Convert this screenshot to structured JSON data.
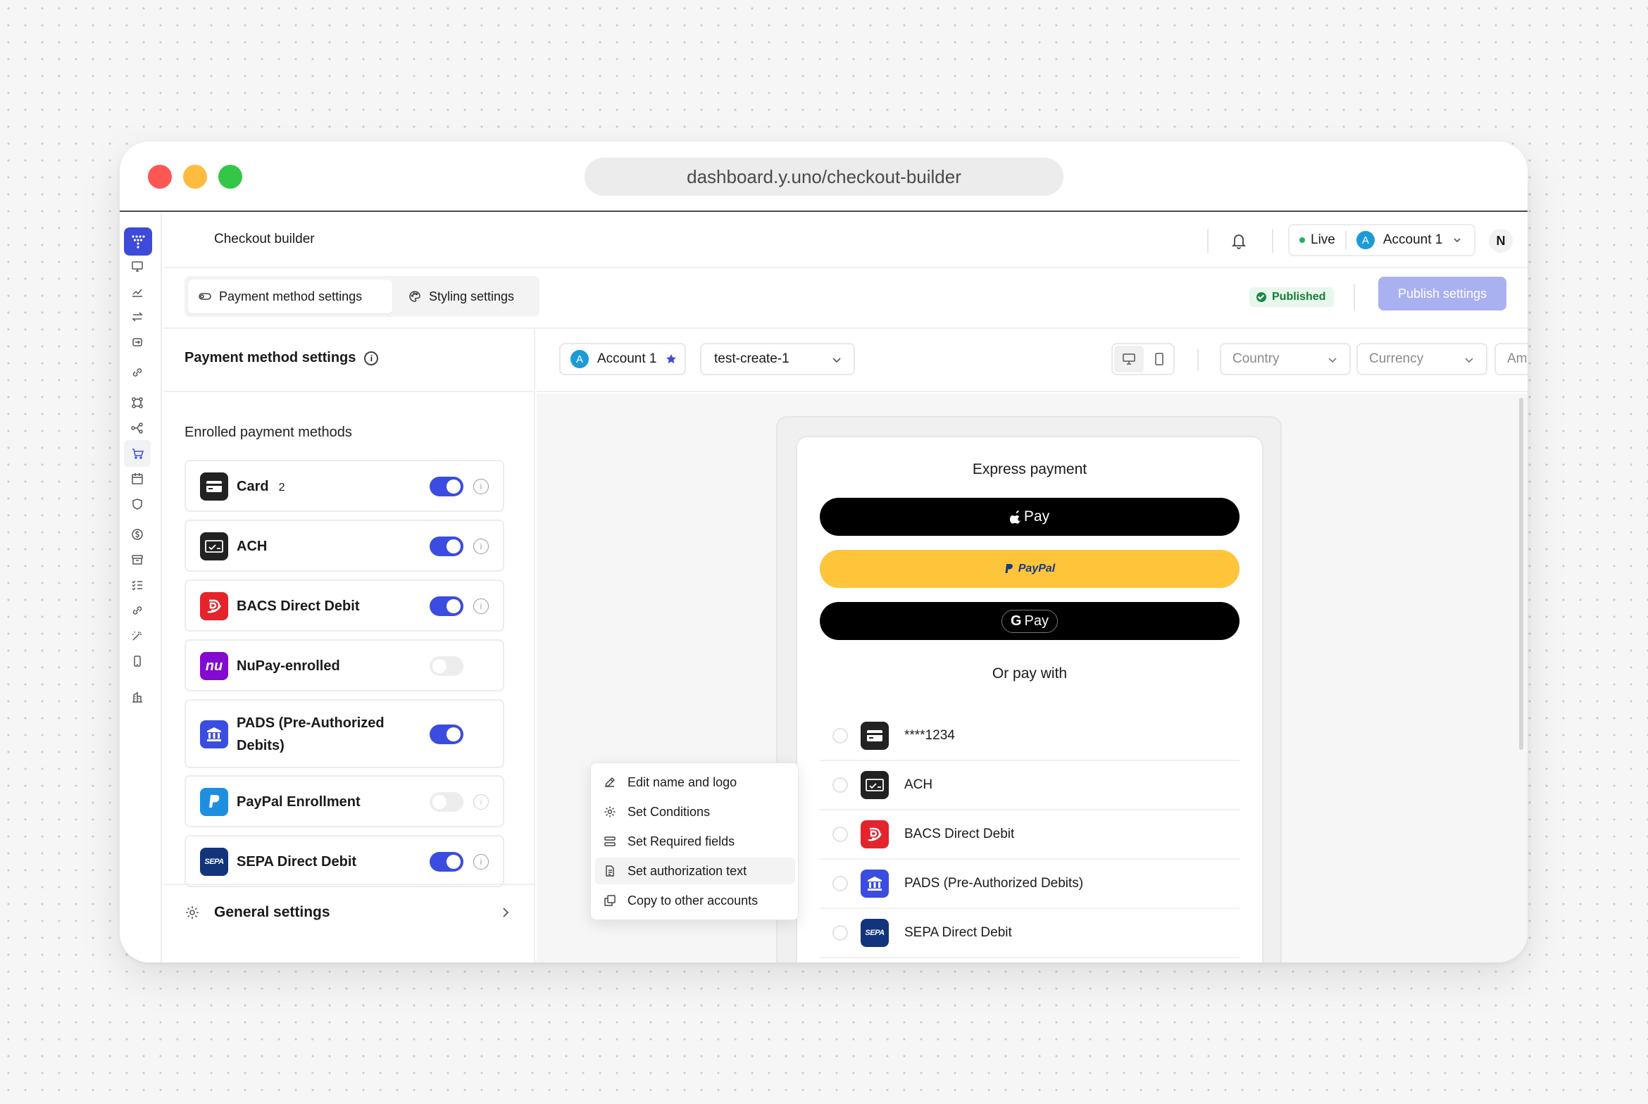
{
  "browser": {
    "url": "dashboard.y.uno/checkout-builder"
  },
  "header": {
    "page_title": "Checkout builder",
    "env_label": "Live",
    "account_initial": "A",
    "account_name": "Account 1",
    "user_initial": "N"
  },
  "tabs": {
    "payment_methods_label": "Payment method settings",
    "styling_label": "Styling settings",
    "status_badge": "Published",
    "publish_button": "Publish settings"
  },
  "left_panel": {
    "title": "Payment method settings",
    "enrolled_label": "Enrolled payment methods",
    "methods": [
      {
        "name": "Card",
        "count": "2",
        "enabled": true
      },
      {
        "name": "ACH",
        "enabled": true
      },
      {
        "name": "BACS Direct Debit",
        "enabled": true
      },
      {
        "name": "NuPay-enrolled",
        "enabled": false
      },
      {
        "name": "PADS (Pre-Authorized Debits)",
        "enabled": true
      },
      {
        "name": "PayPal Enrollment",
        "enabled": false
      },
      {
        "name": "SEPA Direct Debit",
        "enabled": true
      }
    ],
    "general_settings_label": "General settings",
    "logo_texts": {
      "nupay": "nu",
      "sepa": "SEPA"
    }
  },
  "context_menu": {
    "items": [
      "Edit name and logo",
      "Set Conditions",
      "Set Required fields",
      "Set authorization text",
      "Copy to other accounts"
    ],
    "highlighted_index": 3
  },
  "preview_toolbar": {
    "account_initial": "A",
    "account_label": "Account 1",
    "checkout_value": "test-create-1",
    "country_placeholder": "Country",
    "currency_placeholder": "Currency",
    "amount_placeholder": "Amount"
  },
  "preview": {
    "express_title": "Express payment",
    "apple_pay_label": "Pay",
    "paypal_label": "PayPal",
    "gpay_g": "G",
    "gpay_label": "Pay",
    "or_pay_with": "Or pay with",
    "options": [
      "****1234",
      "ACH",
      "BACS Direct Debit",
      "PADS (Pre-Authorized Debits)",
      "SEPA Direct Debit"
    ]
  },
  "colors": {
    "accent": "#3b4de0",
    "publish_disabled": "#a9b1f0",
    "paypal_yellow": "#fec43a",
    "bacs_red": "#e4232b",
    "nupay_purple": "#820ad1",
    "pads_blue": "#3b4de0",
    "paypal_blue": "#1e8fe0",
    "sepa_navy": "#11347a"
  },
  "icons": {
    "rail": [
      "monitor-icon",
      "chart-icon",
      "transfer-icon",
      "refresh-icon",
      "link-icon",
      "nodes-icon",
      "flow-icon",
      "cart-icon",
      "calendar-icon",
      "shield-icon",
      "dollar-icon",
      "archive-icon",
      "checklist-icon",
      "link-icon",
      "magic-wand-icon",
      "phone-icon",
      "building-icon"
    ]
  }
}
